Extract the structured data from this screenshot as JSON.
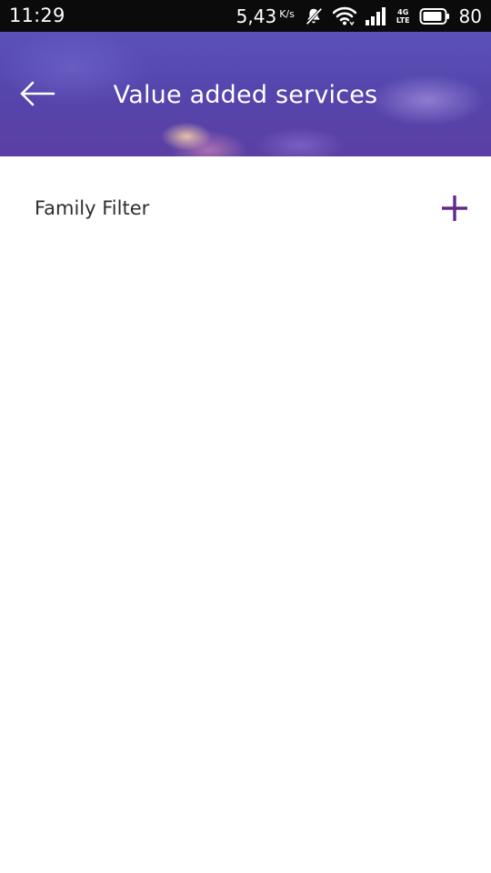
{
  "status_bar": {
    "time": "11:29",
    "net_speed": "5,43",
    "net_unit": "K/s",
    "network_type_top": "4G",
    "network_type_bottom": "LTE",
    "battery_level": "80",
    "icons": [
      "notifications-off-icon",
      "wifi-icon",
      "signal-icon",
      "battery-icon"
    ]
  },
  "header": {
    "title": "Value added services",
    "back_icon": "back-arrow-icon"
  },
  "services": [
    {
      "label": "Family Filter",
      "action_icon": "plus-icon"
    }
  ],
  "colors": {
    "accent": "#5e2b8a",
    "header_base": "#5546ad",
    "text": "#2e2e2e",
    "status_bar": "#0b0b0b"
  }
}
